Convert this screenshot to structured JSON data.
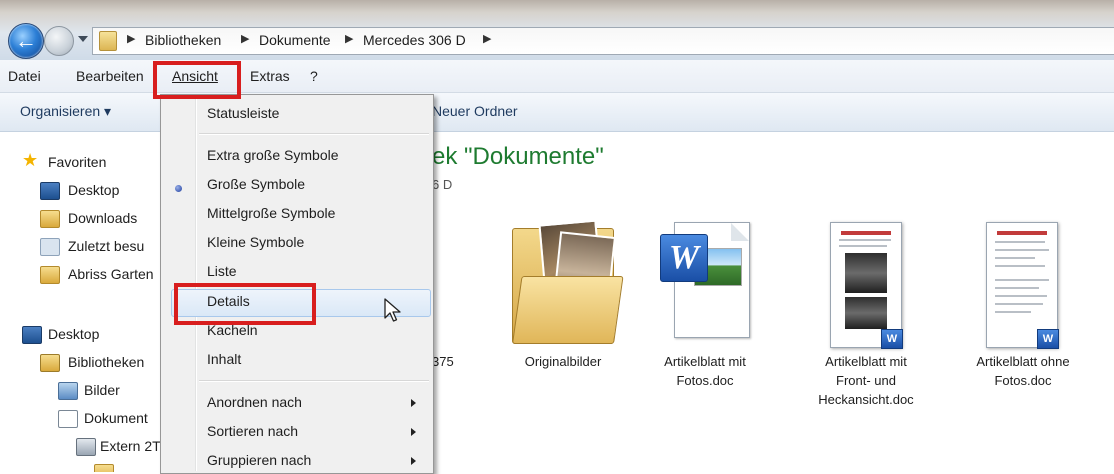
{
  "breadcrumb": {
    "items": [
      "Bibliotheken",
      "Dokumente",
      "Mercedes 306 D"
    ]
  },
  "menubar": {
    "items": [
      "Datei",
      "Bearbeiten",
      "Ansicht",
      "Extras",
      "?"
    ]
  },
  "commandbar": {
    "organize_label": "Organisieren ▾",
    "new_folder_label": "Neuer Ordner"
  },
  "navpane": {
    "favorites": "Favoriten",
    "desktop_fav": "Desktop",
    "downloads": "Downloads",
    "recent": "Zuletzt besu",
    "abriss": "Abriss Garten",
    "desktop": "Desktop",
    "libraries": "Bibliotheken",
    "pictures": "Bilder",
    "documents": "Dokument",
    "extern": "Extern 2T"
  },
  "content": {
    "library_title": "ek \"Dokumente\"",
    "library_subtitle": "6 D",
    "partial_label": "375",
    "files": [
      {
        "line1": "Originalbilder",
        "line2": "",
        "line3": ""
      },
      {
        "line1": "Artikelblatt mit",
        "line2": "Fotos.doc",
        "line3": ""
      },
      {
        "line1": "Artikelblatt mit",
        "line2": "Front- und",
        "line3": "Heckansicht.doc"
      },
      {
        "line1": "Artikelblatt ohne",
        "line2": "Fotos.doc",
        "line3": ""
      }
    ]
  },
  "view_menu": {
    "statusleiste": "Statusleiste",
    "extra_large": "Extra große Symbole",
    "large": "Große Symbole",
    "medium": "Mittelgroße Symbole",
    "small": "Kleine Symbole",
    "list": "Liste",
    "details": "Details",
    "tiles": "Kacheln",
    "content": "Inhalt",
    "arrange_by": "Anordnen nach",
    "sort_by": "Sortieren nach",
    "group_by": "Gruppieren nach"
  },
  "colors": {
    "highlight_outline": "#d81e1e",
    "library_title": "#1e7b30"
  }
}
